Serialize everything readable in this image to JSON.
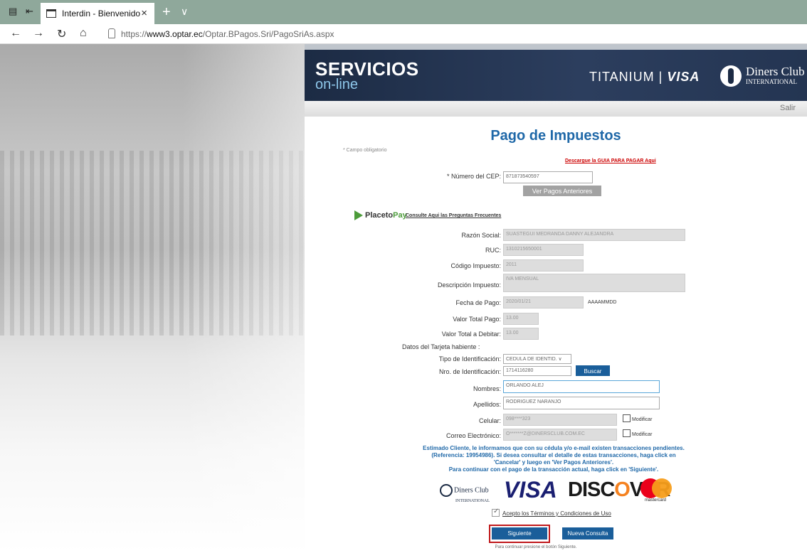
{
  "browser": {
    "tab_title": "Interdin - Bienvenido",
    "url_prefix": "https://",
    "url_host": "www3.optar.ec",
    "url_path": "/Optar.BPagos.Sri/PagoSriAs.aspx"
  },
  "header": {
    "brand_line1": "SERVICIOS",
    "brand_line2": "on-line",
    "titanium": "TITANIUM",
    "visa": "VISA",
    "diners_name": "Diners Club",
    "diners_sub": "INTERNATIONAL",
    "salir": "Salir"
  },
  "page": {
    "title": "Pago de Impuestos",
    "required_note": "* Campo obligatorio",
    "guia_link": "Descargue la GUIA PARA PAGAR Aqui",
    "cep_label": "* Número del CEP:",
    "cep_value": "871873540597",
    "ver_pagos": "Ver Pagos Anteriores",
    "ptp_brand_a": "Placeto",
    "ptp_brand_b": "Pay",
    "preguntas_link": "Consulte Aqui las Preguntas Frecuentes"
  },
  "form": {
    "razon_label": "Razón Social:",
    "razon_value": "SUASTEGUI MEDRANDA DANNY ALEJANDRA",
    "ruc_label": "RUC:",
    "ruc_value": "1310215650001",
    "codigo_label": "Código Impuesto:",
    "codigo_value": "2011",
    "desc_label": "Descripción Impuesto:",
    "desc_value": "IVA MENSUAL",
    "fecha_label": "Fecha de Pago:",
    "fecha_value": "2020/01/21",
    "fecha_fmt": "AAAAMMDD",
    "total_label": "Valor Total Pago:",
    "total_value": "13.00",
    "debitar_label": "Valor Total a Debitar:",
    "debitar_value": "13.00",
    "tarjeta_heading": "Datos del Tarjeta habiente :",
    "tipo_label": "Tipo de Identificación:",
    "tipo_value": "CEDULA DE IDENTID.",
    "nro_label": "Nro. de Identificación:",
    "nro_value": "1714116280",
    "buscar": "Buscar",
    "nombres_label": "Nombres:",
    "nombres_value": "ORLANDO ALEJ",
    "apellidos_label": "Apellidos:",
    "apellidos_value": "RODRIGUEZ NARANJO",
    "celular_label": "Celular:",
    "celular_value": "098****323",
    "modificar": "Modificar",
    "correo_label": "Correo Electrónico:",
    "correo_value": "O*******Z@DINERSCLUB.COM.EC"
  },
  "notice": {
    "line1": "Estimado Cliente, le informamos que con su cédula y/o e-mail existen transacciones pendientes.",
    "line2": "(Referencia: 19954986). Si desea consultar el detalle de estas transacciones, haga click en",
    "line3": "'Cancelar' y luego en 'Ver Pagos Anteriores'.",
    "line4": "Para continuar con el pago de la transacción actual, haga click en 'Siguiente'."
  },
  "cards": {
    "diners": "Diners Club",
    "diners_sub": "INTERNATIONAL",
    "visa": "VISA",
    "discover_a": "DISC",
    "discover_o": "O",
    "discover_b": "VER",
    "mastercard": "mastercard"
  },
  "footer": {
    "terms": "Acepto los Términos y Condiciones de Uso",
    "siguiente": "Siguiente",
    "nueva": "Nueva Consulta",
    "hint": "Para continuar presione el botón Siguiente."
  },
  "colors": {
    "accent": "#1f68a8",
    "button_blue": "#1a5e9a",
    "highlight": "#c0181b"
  }
}
